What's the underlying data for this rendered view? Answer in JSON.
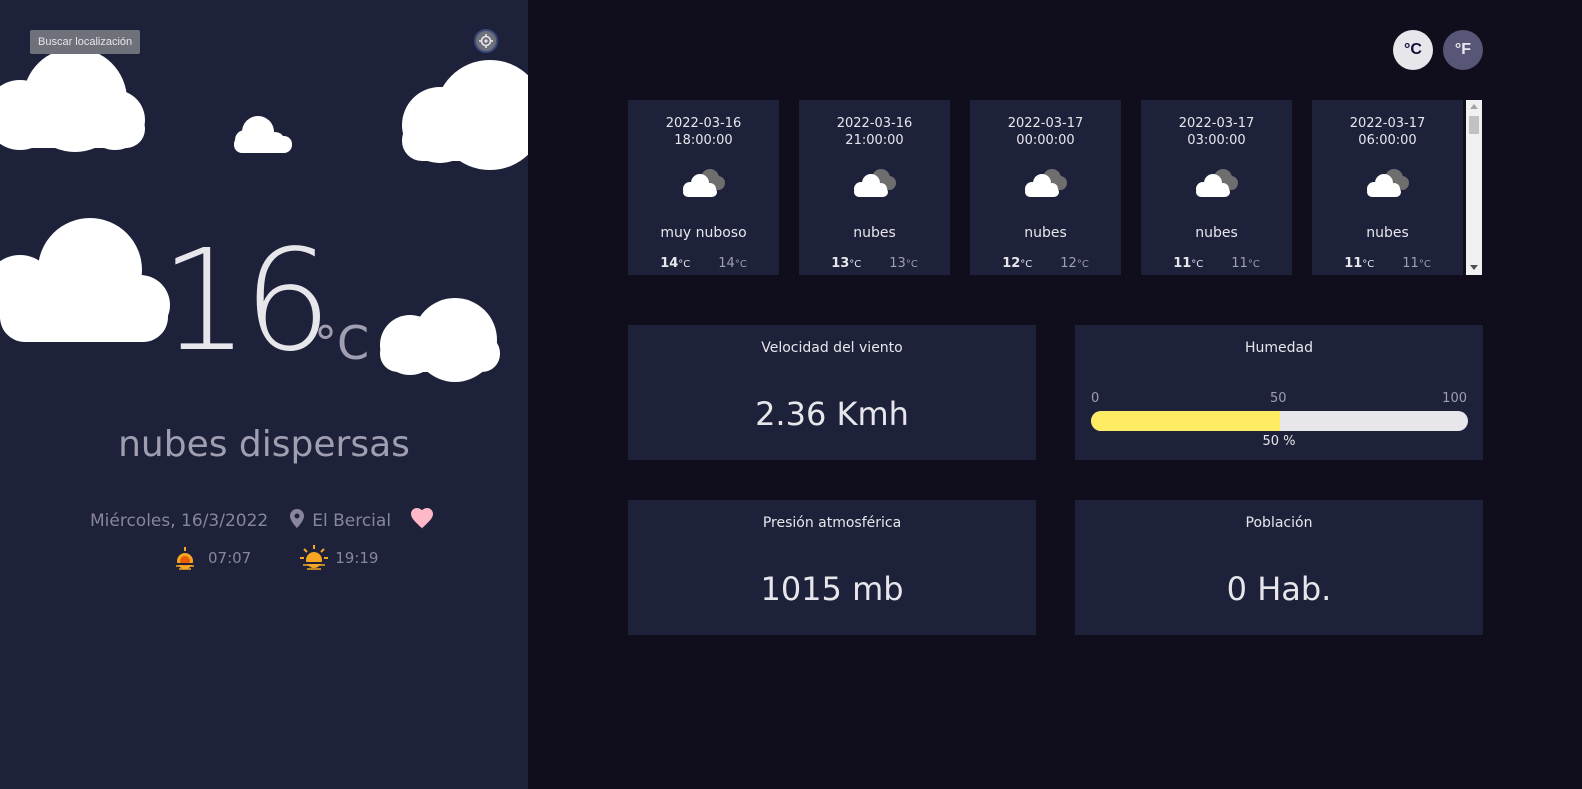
{
  "sidebar": {
    "search_label": "Buscar localización",
    "temperature": "16",
    "temperature_unit": "°C",
    "description": "nubes dispersas",
    "date": "Miércoles, 16/3/2022",
    "location": "El Bercial",
    "sunrise": "07:07",
    "sunset": "19:19"
  },
  "units": {
    "celsius": "°C",
    "fahrenheit": "°F"
  },
  "forecast": [
    {
      "date": "2022-03-16",
      "time": "18:00:00",
      "desc": "muy nuboso",
      "max": "14",
      "min": "14",
      "unit": "°C"
    },
    {
      "date": "2022-03-16",
      "time": "21:00:00",
      "desc": "nubes",
      "max": "13",
      "min": "13",
      "unit": "°C"
    },
    {
      "date": "2022-03-17",
      "time": "00:00:00",
      "desc": "nubes",
      "max": "12",
      "min": "12",
      "unit": "°C"
    },
    {
      "date": "2022-03-17",
      "time": "03:00:00",
      "desc": "nubes",
      "max": "11",
      "min": "11",
      "unit": "°C"
    },
    {
      "date": "2022-03-17",
      "time": "06:00:00",
      "desc": "nubes",
      "max": "11",
      "min": "11",
      "unit": "°C"
    }
  ],
  "highlights": {
    "wind": {
      "title": "Velocidad del viento",
      "value": "2.36 Kmh"
    },
    "humidity": {
      "title": "Humedad",
      "scale_min": "0",
      "scale_mid": "50",
      "scale_max": "100",
      "percent": 50,
      "label": "50 %"
    },
    "pressure": {
      "title": "Presión atmosférica",
      "value": "1015 mb"
    },
    "population": {
      "title": "Población",
      "value": "0 Hab."
    }
  },
  "colors": {
    "sidebar_bg": "#1e213a",
    "page_bg": "#100e1d",
    "bar_fill": "#ffec65",
    "heart": "#ffb8c6"
  }
}
